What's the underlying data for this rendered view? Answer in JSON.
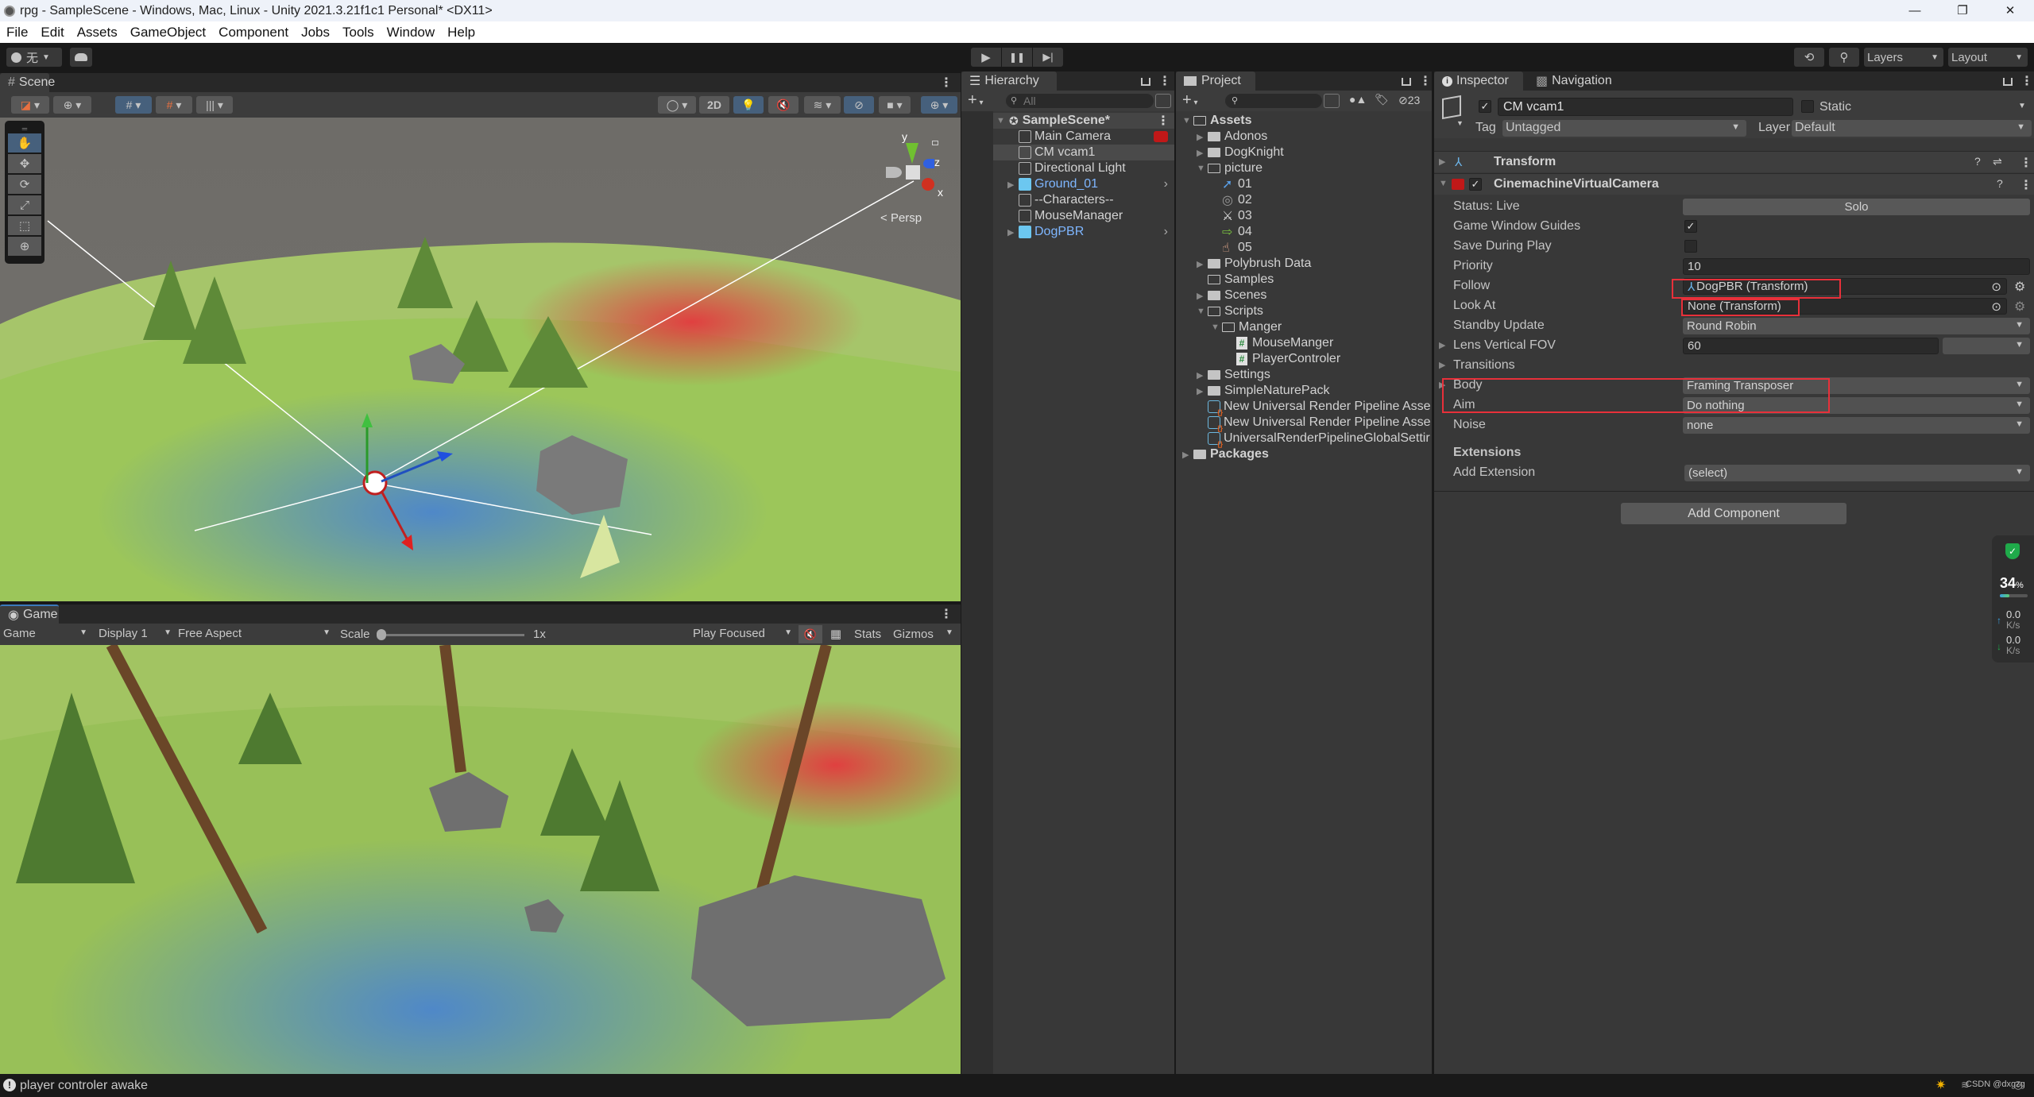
{
  "window": {
    "title": "rpg - SampleScene - Windows, Mac, Linux - Unity 2021.3.21f1c1 Personal* <DX11>",
    "controls": {
      "minimize": "—",
      "maximize": "❐",
      "close": "✕"
    }
  },
  "menu": [
    "File",
    "Edit",
    "Assets",
    "GameObject",
    "Component",
    "Jobs",
    "Tools",
    "Window",
    "Help"
  ],
  "main_toolbar": {
    "account_label": "无",
    "play_icon": "▶",
    "pause_icon": "❚❚",
    "step_icon": "▶|",
    "layers_label": "Layers",
    "layout_label": "Layout"
  },
  "scene": {
    "tab_label": "Scene",
    "toolbar": {
      "btn_2d": "2D"
    },
    "gizmo": {
      "x": "x",
      "y": "y",
      "z": "z",
      "persp": "Persp"
    },
    "tools": [
      "hand-tool",
      "move-tool",
      "rotate-tool",
      "scale-tool",
      "rect-tool",
      "transform-tool"
    ]
  },
  "game": {
    "tab_label": "Game",
    "mode": "Game",
    "display": "Display 1",
    "aspect": "Free Aspect",
    "scale_label": "Scale",
    "scale_value": "1x",
    "play_mode": "Play Focused",
    "stats": "Stats",
    "gizmos": "Gizmos"
  },
  "hierarchy": {
    "tab_label": "Hierarchy",
    "search_placeholder": "All",
    "scene_name": "SampleScene*",
    "items": [
      {
        "label": "Main Camera",
        "prefab": false,
        "expandable": false
      },
      {
        "label": "CM vcam1",
        "prefab": false,
        "expandable": false,
        "selected": true
      },
      {
        "label": "Directional Light",
        "prefab": false,
        "expandable": false
      },
      {
        "label": "Ground_01",
        "prefab": true,
        "expandable": true
      },
      {
        "label": "--Characters--",
        "prefab": false,
        "expandable": false
      },
      {
        "label": "MouseManager",
        "prefab": false,
        "expandable": false
      },
      {
        "label": "DogPBR",
        "prefab": true,
        "expandable": true
      }
    ]
  },
  "project": {
    "tab_label": "Project",
    "hidden_count": "23",
    "tree": [
      {
        "label": "Assets",
        "depth": 0,
        "type": "folder-open",
        "bold": true
      },
      {
        "label": "Adonos",
        "depth": 1,
        "type": "folder"
      },
      {
        "label": "DogKnight",
        "depth": 1,
        "type": "folder"
      },
      {
        "label": "picture",
        "depth": 1,
        "type": "folder-open"
      },
      {
        "label": "01",
        "depth": 2,
        "type": "image-cursor"
      },
      {
        "label": "02",
        "depth": 2,
        "type": "image-target"
      },
      {
        "label": "03",
        "depth": 2,
        "type": "image-sword"
      },
      {
        "label": "04",
        "depth": 2,
        "type": "image-door"
      },
      {
        "label": "05",
        "depth": 2,
        "type": "image-hand"
      },
      {
        "label": "Polybrush Data",
        "depth": 1,
        "type": "folder"
      },
      {
        "label": "Samples",
        "depth": 1,
        "type": "folder-empty"
      },
      {
        "label": "Scenes",
        "depth": 1,
        "type": "folder"
      },
      {
        "label": "Scripts",
        "depth": 1,
        "type": "folder-open"
      },
      {
        "label": "Manger",
        "depth": 2,
        "type": "folder-open"
      },
      {
        "label": "MouseManger",
        "depth": 3,
        "type": "script"
      },
      {
        "label": "PlayerControler",
        "depth": 3,
        "type": "script"
      },
      {
        "label": "Settings",
        "depth": 1,
        "type": "folder"
      },
      {
        "label": "SimpleNaturePack",
        "depth": 1,
        "type": "folder"
      },
      {
        "label": "New Universal Render Pipeline Asse",
        "depth": 1,
        "type": "asset"
      },
      {
        "label": "New Universal Render Pipeline Asse",
        "depth": 1,
        "type": "asset"
      },
      {
        "label": "UniversalRenderPipelineGlobalSettir",
        "depth": 1,
        "type": "asset"
      },
      {
        "label": "Packages",
        "depth": 0,
        "type": "folder",
        "bold": true
      }
    ]
  },
  "inspector": {
    "tab_label": "Inspector",
    "nav_tab_label": "Navigation",
    "object_name": "CM vcam1",
    "object_active": true,
    "static_label": "Static",
    "tag_label": "Tag",
    "tag_value": "Untagged",
    "layer_label": "Layer",
    "layer_value": "Default",
    "components": {
      "transform": "Transform",
      "vcam": "CinemachineVirtualCamera"
    },
    "fields": {
      "status": "Status: Live",
      "solo": "Solo",
      "game_window_guides": "Game Window Guides",
      "game_window_guides_checked": true,
      "save_during_play": "Save During Play",
      "save_during_play_checked": false,
      "priority_label": "Priority",
      "priority_value": "10",
      "follow_label": "Follow",
      "follow_value": "DogPBR (Transform)",
      "look_at_label": "Look At",
      "look_at_value": "None (Transform)",
      "standby_label": "Standby Update",
      "standby_value": "Round Robin",
      "fov_label": "Lens Vertical FOV",
      "fov_value": "60",
      "transitions_label": "Transitions",
      "body_label": "Body",
      "body_value": "Framing Transposer",
      "aim_label": "Aim",
      "aim_value": "Do nothing",
      "noise_label": "Noise",
      "noise_value": "none",
      "extensions_label": "Extensions",
      "add_extension_label": "Add Extension",
      "add_extension_value": "(select)"
    },
    "add_component": "Add Component"
  },
  "overlay_widget": {
    "cpu_percent": "34",
    "percent_sign": "%",
    "cpu_fraction": 0.34,
    "upload": "0.0",
    "download": "0.0",
    "unit": "K/s"
  },
  "status_bar": {
    "message": "player controler awake",
    "watermark": "CSDN @dxgzg"
  },
  "colors": {
    "accent_blue": "#46607c",
    "prefab_blue": "#7eb6ff",
    "highlight_red": "#e8303a"
  }
}
